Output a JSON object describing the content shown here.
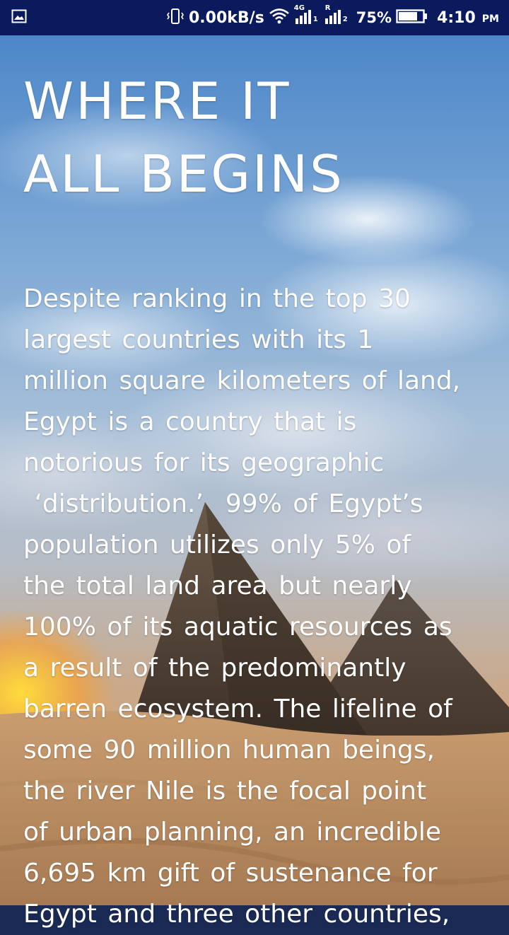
{
  "status_bar": {
    "data_speed": "0.00kB/s",
    "network_1": "4G",
    "network_2": "R",
    "sim_1": "1",
    "sim_2": "2",
    "battery_percent": "75%",
    "time": "4:10",
    "ampm": "PM",
    "icons": [
      "gallery-notification-icon",
      "vibrate-icon",
      "wifi-icon",
      "signal-icon",
      "battery-icon"
    ]
  },
  "article": {
    "title_line_1": "WHERE IT",
    "title_line_2": "ALL BEGINS",
    "body": "Despite ranking in the top 30\nlargest countries with its 1\nmillion square kilometers of land,\nEgypt is a country that is\nnotorious for its geographic\n ‘distribution.’  99% of Egypt’s\npopulation utilizes only 5% of\nthe total land area but nearly\n100% of its aquatic resources as\na result of the predominantly\nbarren ecosystem. The lifeline of\nsome 90 million human beings,\nthe river Nile is the focal point\nof urban planning, an incredible\n6,695 km gift of sustenance for\nEgypt and three other countries,"
  },
  "colors": {
    "status_bar": "#0a1a5c",
    "text": "#ffffff",
    "sky": "#4d87c9",
    "sand": "#cfa67b",
    "pyramid": "#5a4a3c"
  }
}
